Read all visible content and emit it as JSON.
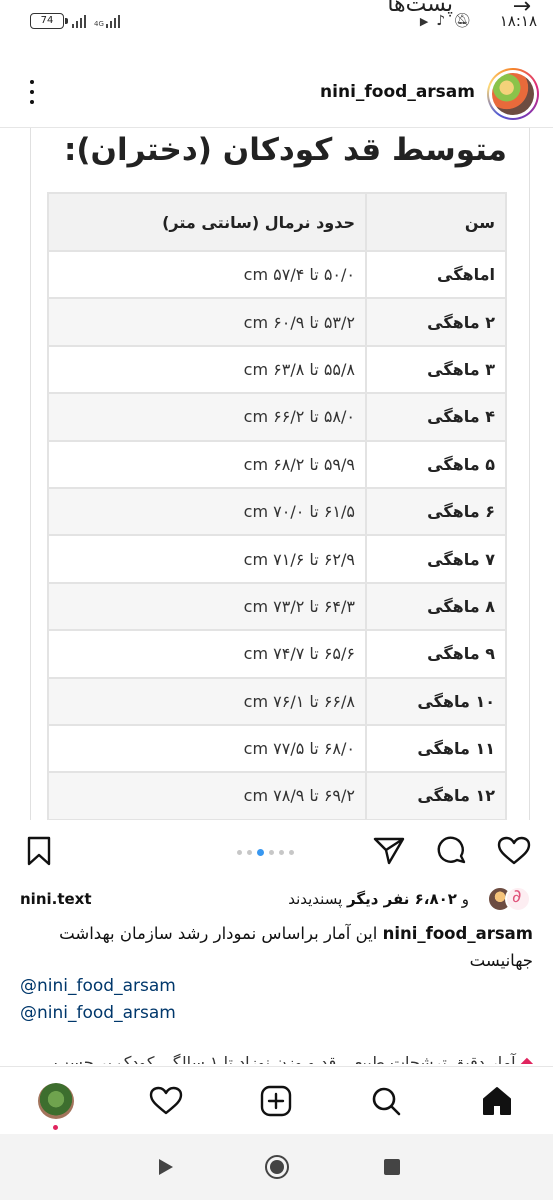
{
  "status_bar": {
    "time": "۱۸:۱۸",
    "battery": "74",
    "network": "4G",
    "peek_title": "پست‌ها"
  },
  "post": {
    "username": "nini_food_arsam"
  },
  "image": {
    "title": "متوسط قد کودکان (دختران):",
    "table": {
      "headers": [
        "سن",
        "حدود نرمال (سانتی متر)"
      ],
      "rows": [
        {
          "age": "اماهگی",
          "height": "۵۰/۰ تا ۵۷/۴ cm"
        },
        {
          "age": "۲ ماهگی",
          "height": "۵۳/۲ تا ۶۰/۹ cm"
        },
        {
          "age": "۳ ماهگی",
          "height": "۵۵/۸ تا ۶۳/۸ cm"
        },
        {
          "age": "۴ ماهگی",
          "height": "۵۸/۰ تا ۶۶/۲ cm"
        },
        {
          "age": "۵ ماهگی",
          "height": "۵۹/۹ تا ۶۸/۲ cm"
        },
        {
          "age": "۶ ماهگی",
          "height": "۶۱/۵ تا ۷۰/۰ cm"
        },
        {
          "age": "۷ ماهگی",
          "height": "۶۲/۹ تا ۷۱/۶ cm"
        },
        {
          "age": "۸ ماهگی",
          "height": "۶۴/۳ تا ۷۳/۲ cm"
        },
        {
          "age": "۹ ماهگی",
          "height": "۶۵/۶ تا ۷۴/۷ cm"
        },
        {
          "age": "۱۰ ماهگی",
          "height": "۶۶/۸ تا ۷۶/۱ cm"
        },
        {
          "age": "۱۱ ماهگی",
          "height": "۶۸/۰ تا ۷۷/۵ cm"
        },
        {
          "age": "۱۲ ماهگی",
          "height": "۶۹/۲ تا ۷۸/۹ cm"
        }
      ]
    }
  },
  "carousel": {
    "count": 6,
    "active_index": 2
  },
  "likes": {
    "prefix": "و",
    "count_text": "۶،۸۰۲ نفر دیگر",
    "suffix": "پسندیدند",
    "user": "nini.text"
  },
  "caption": {
    "user": "nini_food_arsam",
    "text": "این آمار براساس نمودار رشد سازمان بهداشت جهانیست"
  },
  "mentions": [
    "@nini_food_arsam",
    "@nini_food_arsam"
  ],
  "caption_peek": "آمار دقیق ترشحات طبیعی قد و وزن نوزاد تا ۱ سالگی کودک بر حسب"
}
